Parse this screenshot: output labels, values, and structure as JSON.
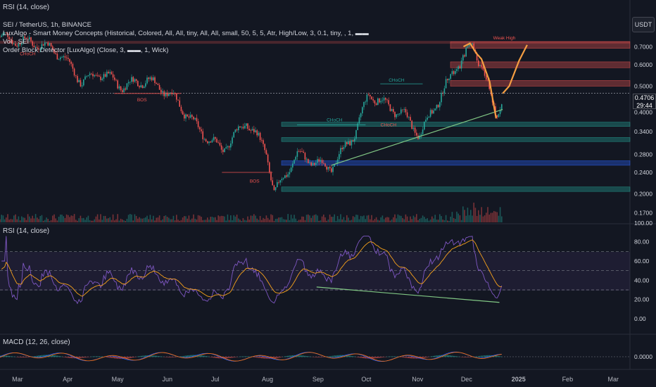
{
  "header": {
    "top_rsi": "RSI (14, close)",
    "symbol": "SEI / TetherUS, 1h, BINANCE",
    "ind_smc": "LuxAlgo - Smart Money Concepts (Historical, Colored, All, All, tiny, All, All, small, 50, 5, 5, Atr, High/Low, 3, 0.1, tiny, , 1, ▬▬, ▬▬, ▬▬)",
    "ind_vol": "Vol · SEI",
    "ind_ob": "Order Block Detector [LuxAlgo] (Close, 3, ▬▬, 1, Wick)"
  },
  "currency_button": "USDT",
  "price_tag": {
    "price": "0.4706",
    "countdown": "29:44"
  },
  "rsi_pane": {
    "title": "RSI (14, close)"
  },
  "macd_pane": {
    "title": "MACD (12, 26, close)"
  },
  "colors": {
    "background": "#131722",
    "up": "#26a69a",
    "down": "#ef5350",
    "rsi": "#7e57c2",
    "rsi_ma": "#f7a21b",
    "trendline": "#81c784",
    "projection": "#f59e42"
  },
  "chart_data": [
    {
      "type": "candlestick",
      "title": "SEI / TetherUS, 1h, BINANCE",
      "y_scale": "log",
      "y_ticks": [
        "0.7000",
        "0.6000",
        "0.5000",
        "0.4000",
        "0.3400",
        "0.2800",
        "0.2400",
        "0.2000",
        "0.1700",
        "100.00"
      ],
      "x_ticks": [
        "Mar",
        "Apr",
        "May",
        "Jun",
        "Jul",
        "Aug",
        "Sep",
        "Oct",
        "Nov",
        "Dec",
        "2025",
        "Feb",
        "Mar"
      ],
      "last_price": 0.4706,
      "path_points": [
        {
          "t": "2024-02-20",
          "v": 0.76
        },
        {
          "t": "2024-03-05",
          "v": 0.73
        },
        {
          "t": "2024-03-15",
          "v": 0.72
        },
        {
          "t": "2024-03-28",
          "v": 0.66
        },
        {
          "t": "2024-04-10",
          "v": 0.52
        },
        {
          "t": "2024-04-22",
          "v": 0.56
        },
        {
          "t": "2024-05-05",
          "v": 0.5
        },
        {
          "t": "2024-05-20",
          "v": 0.53
        },
        {
          "t": "2024-06-05",
          "v": 0.46
        },
        {
          "t": "2024-06-20",
          "v": 0.35
        },
        {
          "t": "2024-07-05",
          "v": 0.29
        },
        {
          "t": "2024-07-20",
          "v": 0.37
        },
        {
          "t": "2024-08-01",
          "v": 0.29
        },
        {
          "t": "2024-08-06",
          "v": 0.2
        },
        {
          "t": "2024-08-20",
          "v": 0.28
        },
        {
          "t": "2024-09-01",
          "v": 0.26
        },
        {
          "t": "2024-09-10",
          "v": 0.25
        },
        {
          "t": "2024-09-25",
          "v": 0.34
        },
        {
          "t": "2024-10-03",
          "v": 0.47
        },
        {
          "t": "2024-10-15",
          "v": 0.42
        },
        {
          "t": "2024-10-25",
          "v": 0.39
        },
        {
          "t": "2024-11-03",
          "v": 0.33
        },
        {
          "t": "2024-11-15",
          "v": 0.45
        },
        {
          "t": "2024-11-25",
          "v": 0.58
        },
        {
          "t": "2024-12-05",
          "v": 0.71
        },
        {
          "t": "2024-12-12",
          "v": 0.58
        },
        {
          "t": "2024-12-20",
          "v": 0.38
        },
        {
          "t": "2024-12-24",
          "v": 0.47
        }
      ],
      "projection": [
        {
          "t": "2024-12-24",
          "v": 0.47
        },
        {
          "t": "2024-12-28",
          "v": 0.5
        },
        {
          "t": "2025-01-03",
          "v": 0.62
        },
        {
          "t": "2025-01-08",
          "v": 0.71
        }
      ],
      "annotations": [
        {
          "text": "CHoCH",
          "t": "2024-03-08",
          "v": 0.65,
          "color": "down"
        },
        {
          "text": "BOS",
          "t": "2024-05-17",
          "v": 0.44,
          "color": "down"
        },
        {
          "text": "BOS",
          "t": "2024-07-25",
          "v": 0.22,
          "color": "down"
        },
        {
          "text": "CHoCH",
          "t": "2024-09-12",
          "v": 0.37,
          "color": "up"
        },
        {
          "text": "CHoCH",
          "t": "2024-10-20",
          "v": 0.52,
          "color": "up"
        },
        {
          "text": "CHoCH",
          "t": "2024-10-15",
          "v": 0.355,
          "color": "down"
        },
        {
          "text": "Weak High",
          "t": "2024-12-25",
          "v": 0.745,
          "color": "down"
        }
      ],
      "zones": [
        {
          "v_top": 0.73,
          "v_bot": 0.69,
          "color": "down"
        },
        {
          "v_top": 0.615,
          "v_bot": 0.585,
          "color": "down"
        },
        {
          "v_top": 0.525,
          "v_bot": 0.5,
          "color": "down"
        },
        {
          "v_top": 0.368,
          "v_bot": 0.355,
          "color": "up"
        },
        {
          "v_top": 0.323,
          "v_bot": 0.312,
          "color": "up"
        },
        {
          "v_top": 0.265,
          "v_bot": 0.255,
          "color": "blue"
        },
        {
          "v_top": 0.212,
          "v_bot": 0.204,
          "color": "up"
        }
      ],
      "trendline": [
        {
          "t": "2024-09-10",
          "v": 0.255
        },
        {
          "t": "2024-12-24",
          "v": 0.41
        }
      ]
    },
    {
      "type": "line",
      "title": "RSI (14, close)",
      "y_ticks": [
        "80.00",
        "60.00",
        "40.00",
        "20.00",
        "0.00"
      ],
      "bands": {
        "upper": 70,
        "middle": 50,
        "lower": 30
      },
      "ylim": [
        0,
        90
      ],
      "divergence_line": [
        {
          "t": "2024-09-01",
          "v": 33
        },
        {
          "t": "2024-12-22",
          "v": 17
        }
      ]
    },
    {
      "type": "line",
      "title": "MACD (12, 26, close)",
      "y_ticks": [
        "0.0000"
      ]
    }
  ]
}
